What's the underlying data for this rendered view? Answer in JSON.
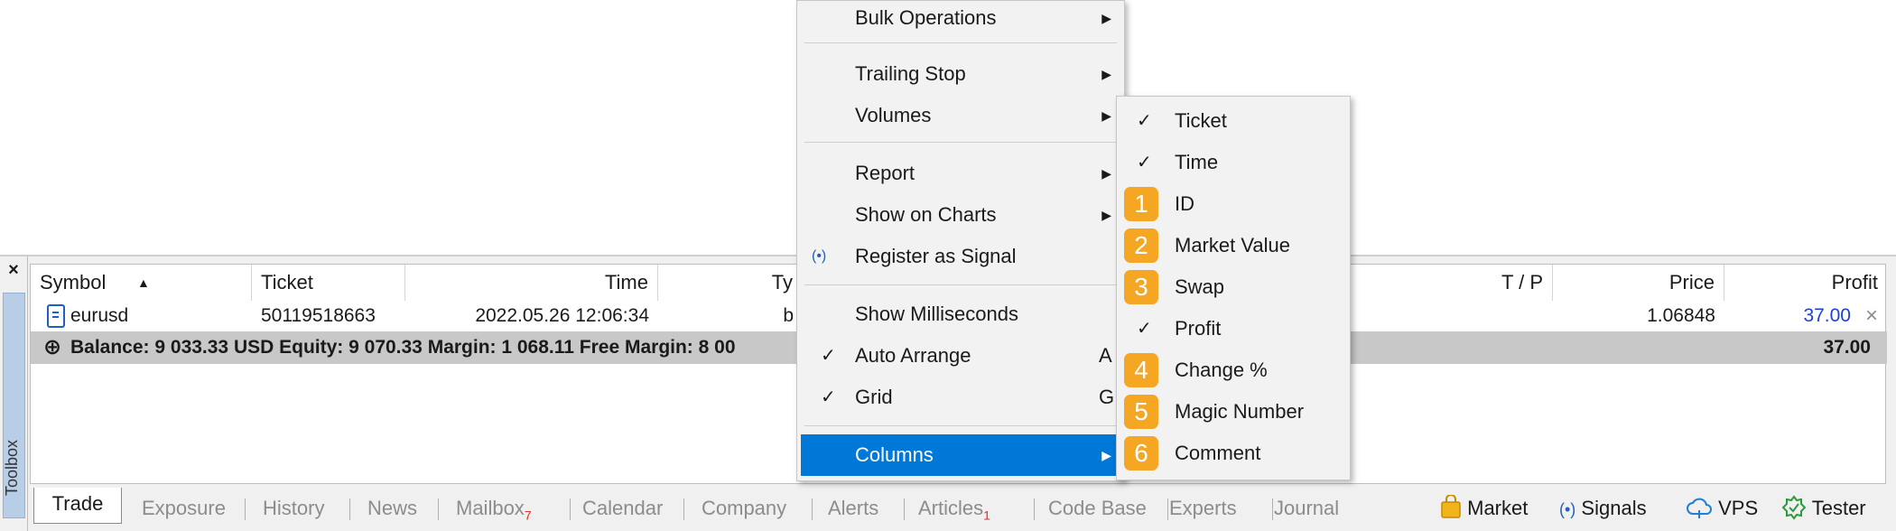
{
  "toolbox": {
    "close": "×",
    "label": "Toolbox"
  },
  "table": {
    "headers": {
      "symbol": "Symbol",
      "ticket": "Ticket",
      "time": "Time",
      "type": "Ty",
      "tp": "T / P",
      "price": "Price",
      "profit": "Profit"
    },
    "sort_indicator": "▲",
    "row": {
      "symbol": "eurusd",
      "ticket": "50119518663",
      "time": "2022.05.26 12:06:34",
      "type": "b",
      "price": "1.06848",
      "profit": "37.00",
      "close": "×"
    },
    "balance": {
      "icon": "⊕",
      "text": "Balance: 9 033.33 USD  Equity: 9 070.33  Margin: 1 068.11  Free Margin: 8 00",
      "profit": "37.00"
    },
    "profit_color": "#1f3fd6"
  },
  "tabs": {
    "trade": "Trade",
    "exposure": "Exposure",
    "history": "History",
    "news": "News",
    "mailbox": "Mailbox",
    "mailbox_count": "7",
    "calendar": "Calendar",
    "company": "Company",
    "alerts": "Alerts",
    "articles": "Articles",
    "articles_count": "1",
    "codebase": "Code Base",
    "experts": "Experts",
    "journal": "Journal"
  },
  "right_links": {
    "market": "Market",
    "signals": "Signals",
    "vps": "VPS",
    "tester": "Tester"
  },
  "context_menu": {
    "bulk": "Bulk Operations",
    "trailing": "Trailing Stop",
    "volumes": "Volumes",
    "report": "Report",
    "show_charts": "Show on Charts",
    "register_signal": "Register as Signal",
    "show_ms": "Show Milliseconds",
    "auto_arrange": "Auto Arrange",
    "auto_arrange_hotkey": "A",
    "grid": "Grid",
    "grid_hotkey": "G",
    "columns": "Columns"
  },
  "columns_submenu": {
    "ticket": "Ticket",
    "time": "Time",
    "id": "ID",
    "market_value": "Market Value",
    "swap": "Swap",
    "profit": "Profit",
    "change": "Change %",
    "magic": "Magic Number",
    "comment": "Comment"
  },
  "badges": [
    "1",
    "2",
    "3",
    "4",
    "5",
    "6"
  ],
  "colors": {
    "accent": "#0078d7",
    "badge": "#f5a623",
    "balance_row": "#c8c8c8"
  }
}
